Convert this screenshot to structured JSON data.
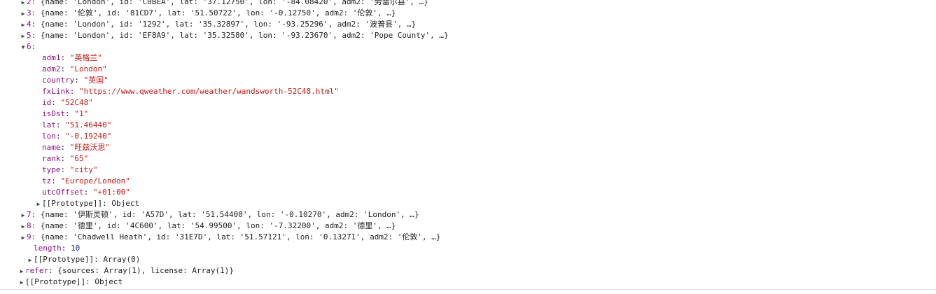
{
  "rows_collapsed_top": [
    {
      "index": "2:",
      "text": "{name: 'London', id: 'C0BEA', lat: '37.12750', lon: '-84.08420', adm2: '劳雷尔县', …}"
    },
    {
      "index": "3:",
      "text": "{name: '伦敦', id: '81CD7', lat: '51.50722', lon: '-0.12750', adm2: '伦敦', …}"
    },
    {
      "index": "4:",
      "text": "{name: 'London', id: '1292', lat: '35.32897', lon: '-93.25296', adm2: '波普县', …}"
    },
    {
      "index": "5:",
      "text": "{name: 'London', id: 'EF8A9', lat: '35.32580', lon: '-93.23670', adm2: 'Pope County', …}"
    }
  ],
  "expanded": {
    "index": "6:",
    "props": [
      {
        "key": "adm1",
        "value": "\"英格兰\""
      },
      {
        "key": "adm2",
        "value": "\"London\""
      },
      {
        "key": "country",
        "value": "\"英国\""
      },
      {
        "key": "fxLink",
        "value": "\"https://www.qweather.com/weather/wandsworth-52C48.html\""
      },
      {
        "key": "id",
        "value": "\"52C48\""
      },
      {
        "key": "isDst",
        "value": "\"1\""
      },
      {
        "key": "lat",
        "value": "\"51.46440\""
      },
      {
        "key": "lon",
        "value": "\"-0.19240\""
      },
      {
        "key": "name",
        "value": "\"旺兹沃思\""
      },
      {
        "key": "rank",
        "value": "\"65\""
      },
      {
        "key": "type",
        "value": "\"city\""
      },
      {
        "key": "tz",
        "value": "\"Europe/London\""
      },
      {
        "key": "utcOffset",
        "value": "\"+01:00\""
      }
    ],
    "prototype": "[[Prototype]]: Object"
  },
  "rows_collapsed_bottom": [
    {
      "index": "7:",
      "text": "{name: '伊斯灵顿', id: 'A57D', lat: '51.54400', lon: '-0.10270', adm2: 'London', …}"
    },
    {
      "index": "8:",
      "text": "{name: '德里', id: '4C600', lat: '54.99500', lon: '-7.32200', adm2: '德里', …}"
    },
    {
      "index": "9:",
      "text": "{name: 'Chadwell Heath', id: '31E7D', lat: '51.57121', lon: '0.13271', adm2: '伦敦', …}"
    }
  ],
  "array_length_key": "length",
  "array_length_value": "10",
  "array_prototype": "[[Prototype]]: Array(0)",
  "refer": {
    "key": "refer",
    "value": "{sources: Array(1), license: Array(1)}"
  },
  "root_prototype": "[[Prototype]]: Object"
}
